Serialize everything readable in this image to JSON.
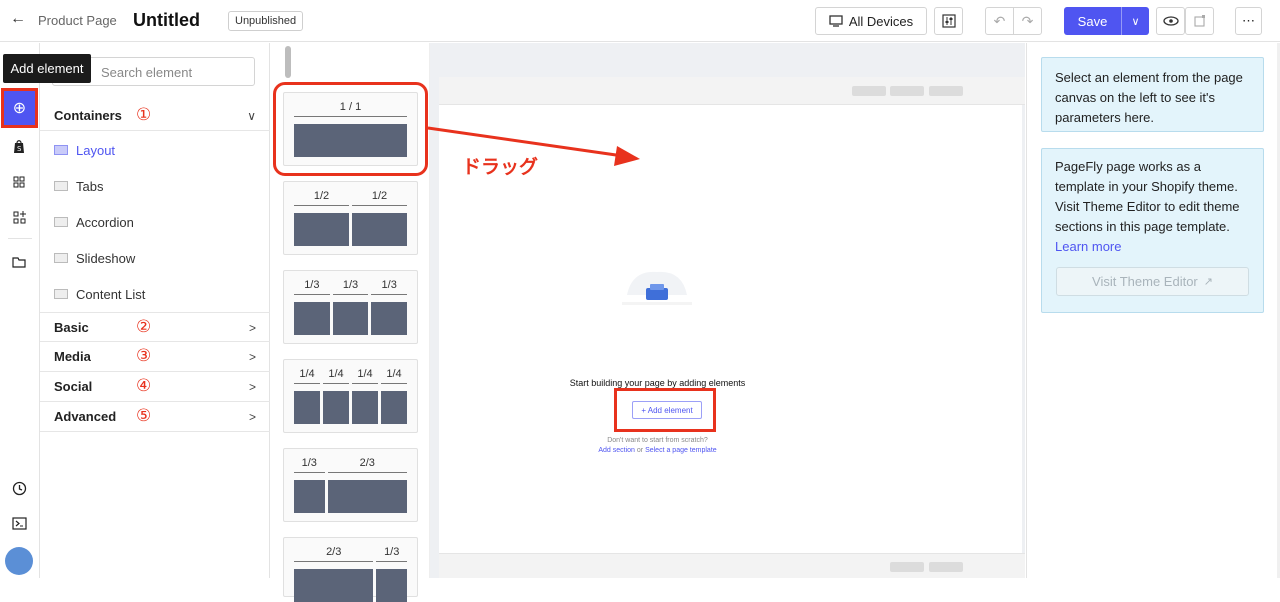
{
  "header": {
    "back_icon": "arrow-left-icon",
    "breadcrumb": "Product Page",
    "title": "Untitled",
    "status": "Unpublished",
    "devices_label": "All Devices",
    "save_label": "Save",
    "colors": {
      "accent": "#4f55f1",
      "annotation": "#e8321d"
    }
  },
  "iconbar": {
    "tooltip": "Add element",
    "items": [
      "add-element-icon",
      "shopify-icon",
      "grid-icon",
      "grid-plus-icon",
      "folder-icon"
    ],
    "bottom": [
      "history-icon",
      "terminal-icon",
      "avatar"
    ]
  },
  "panel": {
    "search_placeholder": "Search element",
    "categories": [
      {
        "name": "Containers",
        "num": "①"
      },
      {
        "name": "Basic",
        "num": "②"
      },
      {
        "name": "Media",
        "num": "③"
      },
      {
        "name": "Social",
        "num": "④"
      },
      {
        "name": "Advanced",
        "num": "⑤"
      }
    ],
    "container_items": [
      "Layout",
      "Tabs",
      "Accordion",
      "Slideshow",
      "Content List"
    ]
  },
  "layouts": [
    {
      "labels": [
        "1 / 1"
      ]
    },
    {
      "labels": [
        "1/2",
        "1/2"
      ]
    },
    {
      "labels": [
        "1/3",
        "1/3",
        "1/3"
      ]
    },
    {
      "labels": [
        "1/4",
        "1/4",
        "1/4",
        "1/4"
      ]
    },
    {
      "labels": [
        "1/3",
        "2/3"
      ]
    },
    {
      "labels": [
        "2/3",
        "1/3"
      ]
    }
  ],
  "annotation": {
    "drag_label": "ドラッグ"
  },
  "canvas": {
    "empty_title": "Start building your page by adding elements",
    "add_element": "+ Add element",
    "scratch": "Don't want to start from scratch?",
    "add_section": "Add section",
    "or": "or",
    "select_template": "Select a page template"
  },
  "right": {
    "info1": "Select an element from the page canvas on the left to see it's parameters here.",
    "info2": "PageFly page works as a template in your Shopify theme. Visit Theme Editor to edit theme sections in this page template.",
    "learn_more": "Learn more",
    "visit_button": "Visit Theme Editor"
  }
}
